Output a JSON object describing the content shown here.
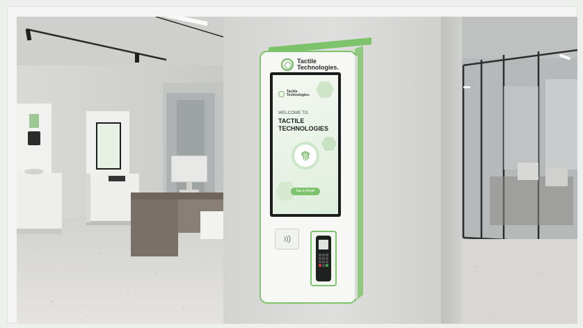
{
  "kiosk": {
    "brand_line1": "Tactile",
    "brand_line2": "Technologies.",
    "screen": {
      "brand_line1": "Tactile",
      "brand_line2": "Technologies.",
      "welcome": "WELCOME TO",
      "title_line1": "TACTILE",
      "title_line2": "TECHNOLOGIES",
      "cta_button": "Tap to Begin"
    }
  },
  "icons": {
    "fingerprint": "fingerprint-icon",
    "contactless": "contactless-icon",
    "logo": "tactile-logo-icon"
  },
  "colors": {
    "accent_green": "#7cc36b",
    "frame_white": "#f7f8f5",
    "wall_gray": "#d9d9d6",
    "screen_dark": "#1a1d1b"
  }
}
